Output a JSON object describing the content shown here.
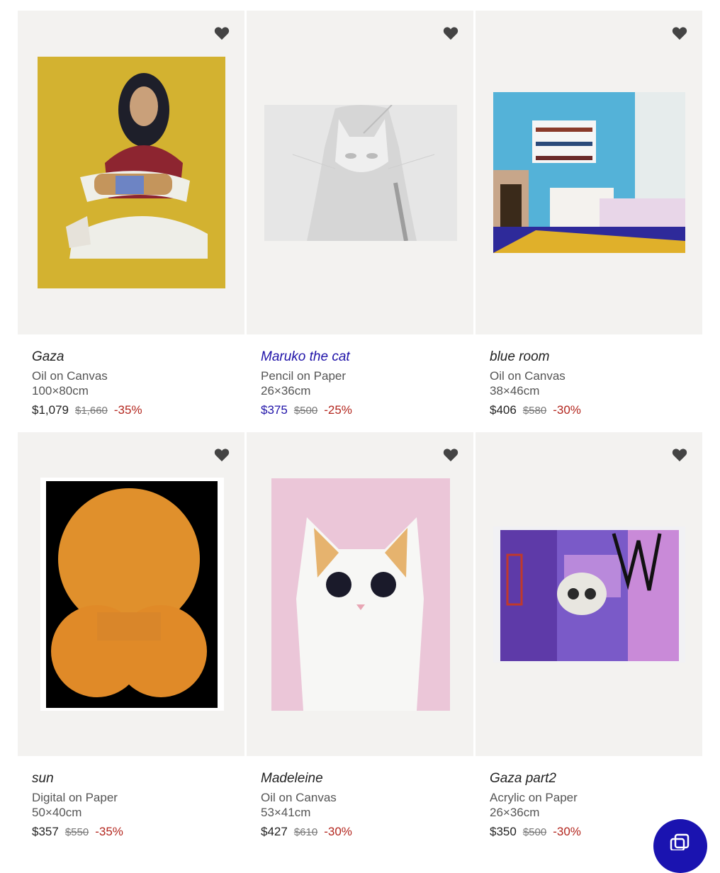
{
  "artworks": [
    {
      "title": "Gaza",
      "medium": "Oil on Canvas",
      "size": "100×80cm",
      "price": "$1,079",
      "original_price": "$1,660",
      "discount": "-35%"
    },
    {
      "title": "Maruko the cat",
      "medium": "Pencil on Paper",
      "size": "26×36cm",
      "price": "$375",
      "original_price": "$500",
      "discount": "-25%"
    },
    {
      "title": "blue room",
      "medium": "Oil on Canvas",
      "size": "38×46cm",
      "price": "$406",
      "original_price": "$580",
      "discount": "-30%"
    },
    {
      "title": "sun",
      "medium": "Digital on Paper",
      "size": "50×40cm",
      "price": "$357",
      "original_price": "$550",
      "discount": "-35%"
    },
    {
      "title": "Madeleine",
      "medium": "Oil on Canvas",
      "size": "53×41cm",
      "price": "$427",
      "original_price": "$610",
      "discount": "-30%"
    },
    {
      "title": "Gaza part2",
      "medium": "Acrylic on Paper",
      "size": "26×36cm",
      "price": "$350",
      "original_price": "$500",
      "discount": "-30%"
    }
  ],
  "icons": {
    "favorite": "heart-icon",
    "chat": "chat-icon"
  },
  "colors": {
    "link": "#1f12a8",
    "discount": "#b3261e",
    "card_bg": "#f3f2f0",
    "chat_button": "#1a13b0"
  }
}
